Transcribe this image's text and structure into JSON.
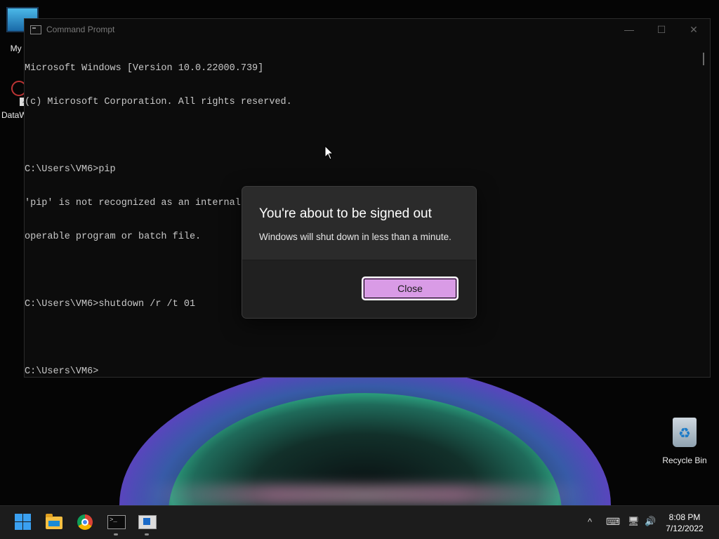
{
  "desktop": {
    "icons": [
      {
        "label": "My Co"
      },
      {
        "label": "DataW"
      },
      {
        "label": "Recycle Bin"
      }
    ]
  },
  "cmd_window": {
    "title": "Command Prompt",
    "controls": {
      "minimize": "—",
      "maximize": "☐",
      "close": "✕"
    },
    "lines": [
      "Microsoft Windows [Version 10.0.22000.739]",
      "(c) Microsoft Corporation. All rights reserved.",
      "",
      "C:\\Users\\VM6>pip",
      "'pip' is not recognized as an internal or external command,",
      "operable program or batch file.",
      "",
      "C:\\Users\\VM6>shutdown /r /t 01",
      "",
      "C:\\Users\\VM6>"
    ]
  },
  "dialog": {
    "title": "You're about to be signed out",
    "message": "Windows will shut down in less than a minute.",
    "close_label": "Close",
    "accent_color": "#d99be6"
  },
  "taskbar": {
    "apps": [
      "start-icon",
      "file-explorer-icon",
      "chrome-icon",
      "command-prompt-icon",
      "app-window-icon"
    ],
    "tray": {
      "chevron": "^",
      "keyboard": "⌨",
      "network": "🖥",
      "volume": "🔊"
    },
    "clock": {
      "time": "8:08 PM",
      "date": "7/12/2022"
    }
  }
}
